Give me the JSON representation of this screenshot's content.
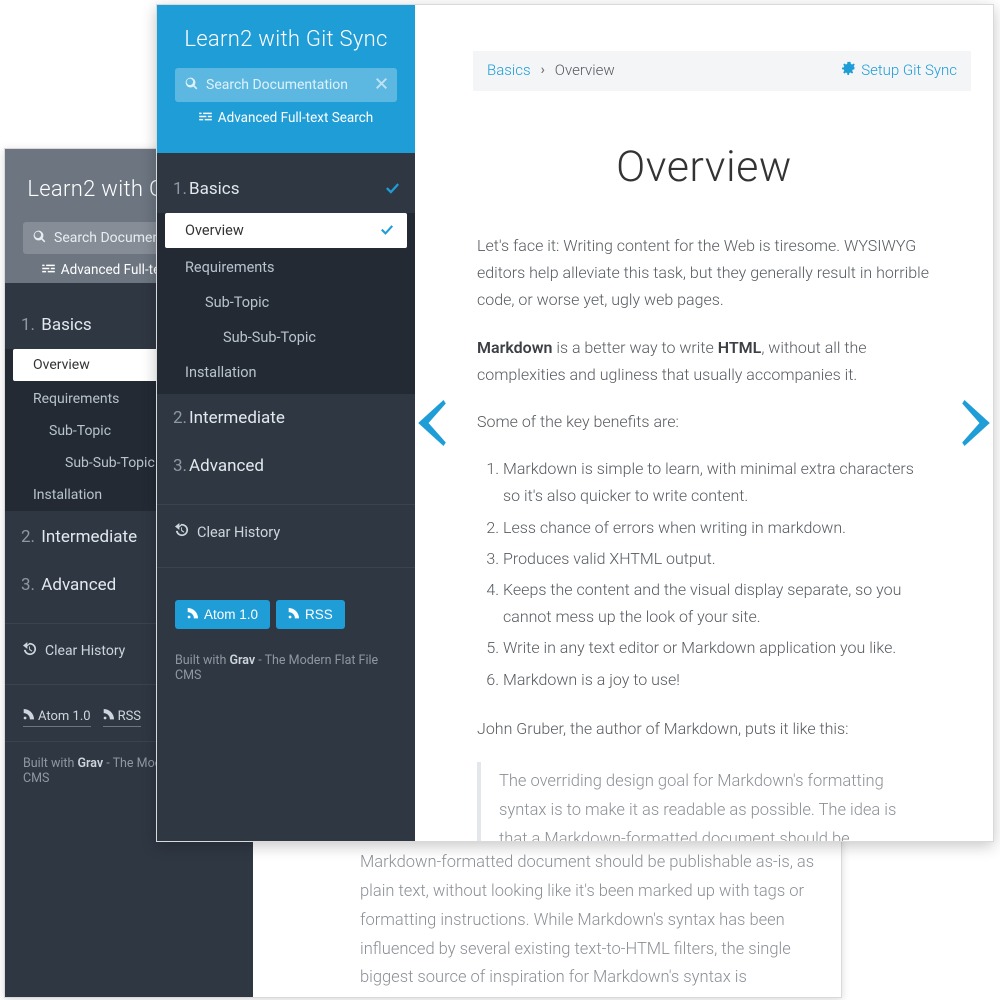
{
  "brand": "Learn2 with Git Sync",
  "search": {
    "placeholder": "Search Documentation"
  },
  "advanced_search": "Advanced Full-text Search",
  "nav": {
    "basics": {
      "num": "1.",
      "label": "Basics",
      "items": {
        "overview": "Overview",
        "requirements": "Requirements",
        "subtopic": "Sub-Topic",
        "subsubtopic": "Sub-Sub-Topic",
        "installation": "Installation"
      }
    },
    "intermediate": {
      "num": "2.",
      "label": "Intermediate"
    },
    "advanced": {
      "num": "3.",
      "label": "Advanced"
    }
  },
  "clear_history": "Clear History",
  "feeds": {
    "atom": "Atom 1.0",
    "rss": "RSS"
  },
  "built": {
    "pre": "Built with ",
    "name": "Grav",
    "post": " - The Modern Flat File CMS"
  },
  "topbar": {
    "crumb_root": "Basics",
    "crumb_current": "Overview",
    "git_sync": "Setup Git Sync"
  },
  "page": {
    "title": "Overview",
    "p1": "Let's face it: Writing content for the Web is tiresome. WYSIWYG editors help alleviate this task, but they generally result in horrible code, or worse yet, ugly web pages.",
    "p2_pre": "",
    "p2_md": "Markdown",
    "p2_mid": " is a better way to write ",
    "p2_html": "HTML",
    "p2_post": ", without all the complexities and ugliness that usually accompanies it.",
    "p3": "Some of the key benefits are:",
    "benefits": [
      "Markdown is simple to learn, with minimal extra characters so it's also quicker to write content.",
      "Less chance of errors when writing in markdown.",
      "Produces valid XHTML output.",
      "Keeps the content and the visual display separate, so you cannot mess up the look of your site.",
      "Write in any text editor or Markdown application you like.",
      "Markdown is a joy to use!"
    ],
    "p4": "John Gruber, the author of Markdown, puts it like this:",
    "quote": "The overriding design goal for Markdown's formatting syntax is to make it as readable as possible. The idea is that a Markdown-formatted document should be publishable as-is, as plain text, without looking like it's been marked up with tags or formatting instructions. While Markdown's syntax has been influenced by several existing text-to-HTML filters, the single biggest source of inspiration for Markdown's syntax is",
    "back_quote": "is to make it as readable as possible. The idea is that a Markdown-formatted document should be publishable as-is, as plain text, without looking like it's been marked up with tags or formatting instructions. While Markdown's syntax has been influenced by several existing text-to-HTML filters, the single biggest source of inspiration for Markdown's syntax is"
  }
}
